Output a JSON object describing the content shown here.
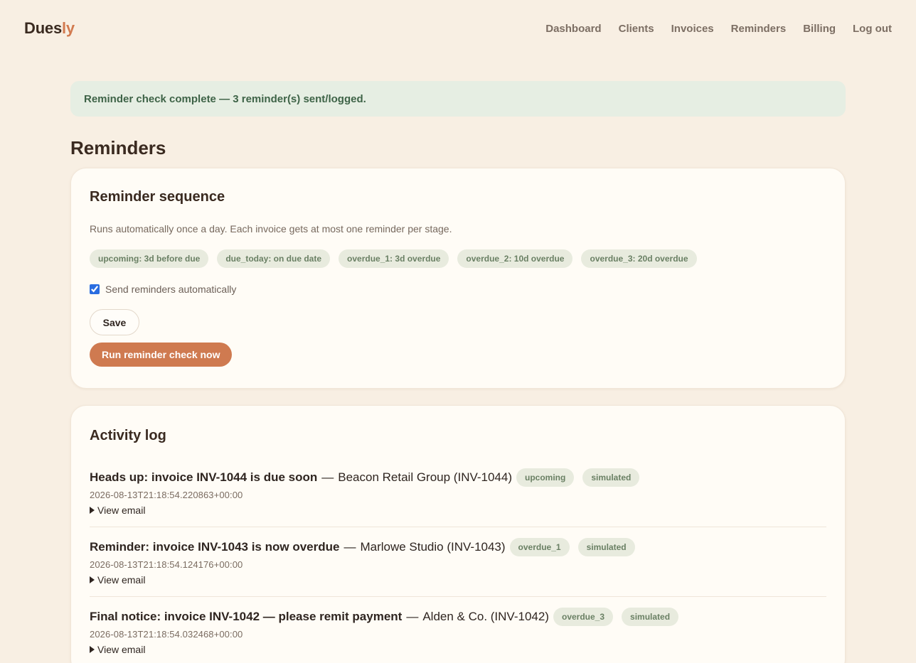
{
  "brand": {
    "name_main": "Dues",
    "name_accent": "ly",
    "accent_color": "#d27a4f"
  },
  "nav": [
    "Dashboard",
    "Clients",
    "Invoices",
    "Reminders",
    "Billing",
    "Log out"
  ],
  "flash": "Reminder check complete — 3 reminder(s) sent/logged.",
  "page_title": "Reminders",
  "sequence": {
    "title": "Reminder sequence",
    "description": "Runs automatically once a day. Each invoice gets at most one reminder per stage.",
    "stages": [
      "upcoming: 3d before due",
      "due_today: on due date",
      "overdue_1: 3d overdue",
      "overdue_2: 10d overdue",
      "overdue_3: 20d overdue"
    ],
    "auto_label": "Send reminders automatically",
    "auto_checked": true,
    "save_label": "Save",
    "run_label": "Run reminder check now",
    "run_color": "#cf7a50"
  },
  "activity": {
    "title": "Activity log",
    "separator": "—",
    "view_email_label": "View email",
    "entries": [
      {
        "subject": "Heads up: invoice INV-1044 is due soon",
        "client": "Beacon Retail Group (INV-1044)",
        "stage": "upcoming",
        "mode": "simulated",
        "timestamp": "2026-08-13T21:18:54.220863+00:00"
      },
      {
        "subject": "Reminder: invoice INV-1043 is now overdue",
        "client": "Marlowe Studio (INV-1043)",
        "stage": "overdue_1",
        "mode": "simulated",
        "timestamp": "2026-08-13T21:18:54.124176+00:00"
      },
      {
        "subject": "Final notice: invoice INV-1042 — please remit payment",
        "client": "Alden & Co. (INV-1042)",
        "stage": "overdue_3",
        "mode": "simulated",
        "timestamp": "2026-08-13T21:18:54.032468+00:00"
      }
    ]
  }
}
